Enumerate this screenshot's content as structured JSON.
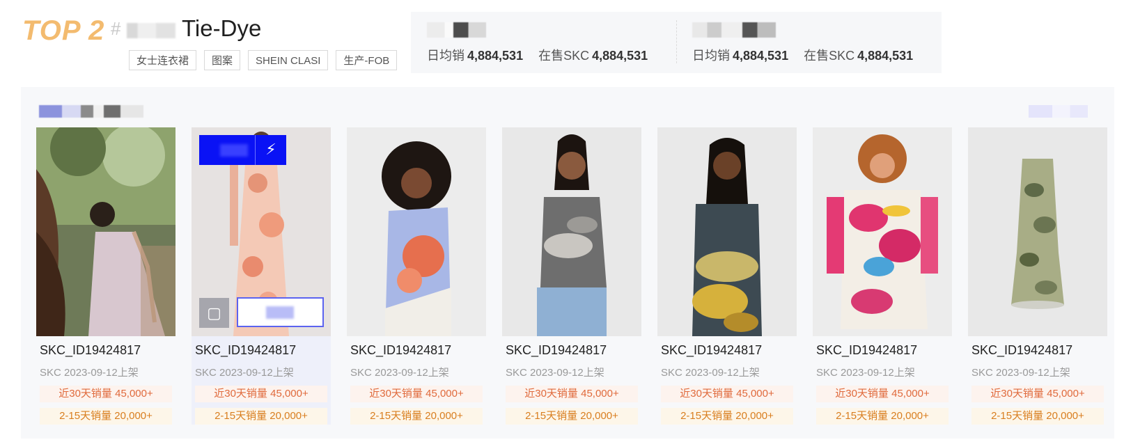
{
  "header": {
    "rank_label": "TOP 2",
    "hash": "#",
    "trend_title": "Tie-Dye",
    "tags": [
      "女士连衣裙",
      "图案",
      "SHEIN CLASI",
      "生产-FOB"
    ]
  },
  "stats": [
    {
      "daily_sales_label": "日均销",
      "daily_sales_value": "4,884,531",
      "skc_label": "在售SKC",
      "skc_value": "4,884,531"
    },
    {
      "daily_sales_label": "日均销",
      "daily_sales_value": "4,884,531",
      "skc_label": "在售SKC",
      "skc_value": "4,884,531"
    }
  ],
  "products": [
    {
      "id": "SKC_ID19424817",
      "date": "SKC 2023-09-12上架",
      "sales_30": "近30天销量 45,000+",
      "sales_2_15": "2-15天销量 20,000+"
    },
    {
      "id": "SKC_ID19424817",
      "date": "SKC 2023-09-12上架",
      "sales_30": "近30天销量 45,000+",
      "sales_2_15": "2-15天销量 20,000+"
    },
    {
      "id": "SKC_ID19424817",
      "date": "SKC 2023-09-12上架",
      "sales_30": "近30天销量 45,000+",
      "sales_2_15": "2-15天销量 20,000+"
    },
    {
      "id": "SKC_ID19424817",
      "date": "SKC 2023-09-12上架",
      "sales_30": "近30天销量 45,000+",
      "sales_2_15": "2-15天销量 20,000+"
    },
    {
      "id": "SKC_ID19424817",
      "date": "SKC 2023-09-12上架",
      "sales_30": "近30天销量 45,000+",
      "sales_2_15": "2-15天销量 20,000+"
    },
    {
      "id": "SKC_ID19424817",
      "date": "SKC 2023-09-12上架",
      "sales_30": "近30天销量 45,000+",
      "sales_2_15": "2-15天销量 20,000+"
    },
    {
      "id": "SKC_ID19424817",
      "date": "SKC 2023-09-12上架",
      "sales_30": "近30天销量 45,000+",
      "sales_2_15": "2-15天销量 20,000+"
    }
  ],
  "icons": {
    "hover_action_icon": "lightning-icon",
    "image_search_icon": "scan-icon"
  },
  "colors": {
    "rank": "#f3bb6f",
    "accent_blue": "#0a12f5",
    "sales_30_text": "#e06a3c",
    "sales_2_15_text": "#d97e1f"
  }
}
